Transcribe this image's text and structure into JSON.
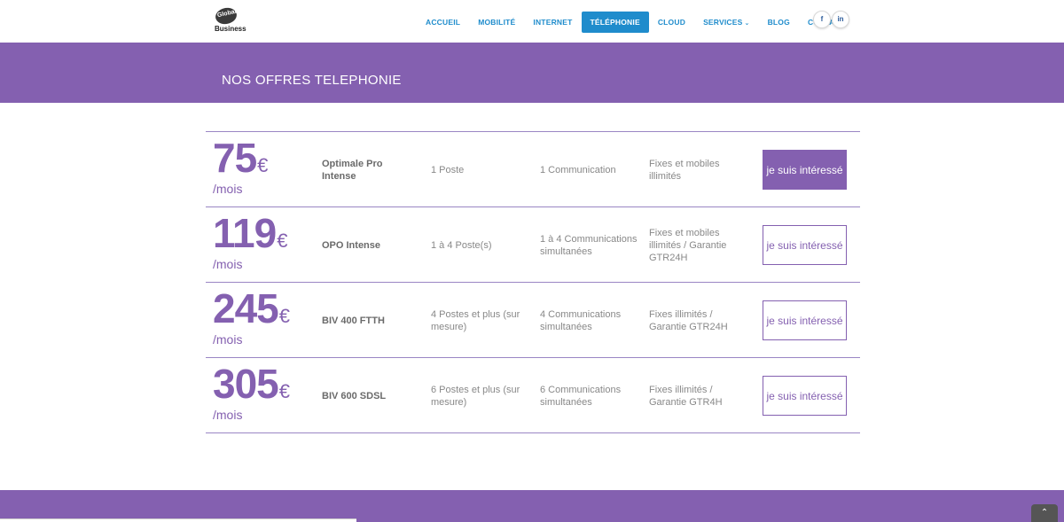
{
  "logo": {
    "line1": "Global",
    "line2": "Business"
  },
  "nav": [
    {
      "label": "ACCUEIL",
      "active": false
    },
    {
      "label": "MOBILITÉ",
      "active": false
    },
    {
      "label": "INTERNET",
      "active": false
    },
    {
      "label": "TÉLÉPHONIE",
      "active": true
    },
    {
      "label": "CLOUD",
      "active": false
    },
    {
      "label": "SERVICES",
      "active": false
    },
    {
      "label": "BLOG",
      "active": false
    },
    {
      "label": "CONTACT",
      "active": false
    }
  ],
  "social": {
    "facebook": "f",
    "linkedin": "in"
  },
  "banner": {
    "title": "NOS OFFRES TELEPHONIE"
  },
  "colors": {
    "brand": "#8460b0",
    "nav_accent": "#1f8ccc"
  },
  "offers": [
    {
      "price": "75",
      "currency": "€",
      "period": "/mois",
      "name": "Optimale Pro Intense",
      "postes": "1 Poste",
      "communications": "1 Communication",
      "fixes": "Fixes et mobiles illimités",
      "button": "je suis intéressé"
    },
    {
      "price": "119",
      "currency": "€",
      "period": "/mois",
      "name": "OPO Intense",
      "postes": "1 à 4 Poste(s)",
      "communications": "1 à 4 Communications simultanées",
      "fixes": "Fixes et mobiles illimités / Garantie GTR24H",
      "button": "je suis intéressé"
    },
    {
      "price": "245",
      "currency": "€",
      "period": "/mois",
      "name": "BIV 400 FTTH",
      "postes": "4 Postes et plus (sur mesure)",
      "communications": "4 Communications simultanées",
      "fixes": "Fixes illimités / Garantie GTR24H",
      "button": "je suis intéressé"
    },
    {
      "price": "305",
      "currency": "€",
      "period": "/mois",
      "name": "BIV 600 SDSL",
      "postes": "6 Postes et plus (sur mesure)",
      "communications": "6 Communications simultanées",
      "fixes": "Fixes illimités / Garantie GTR4H",
      "button": "je suis intéressé"
    }
  ]
}
